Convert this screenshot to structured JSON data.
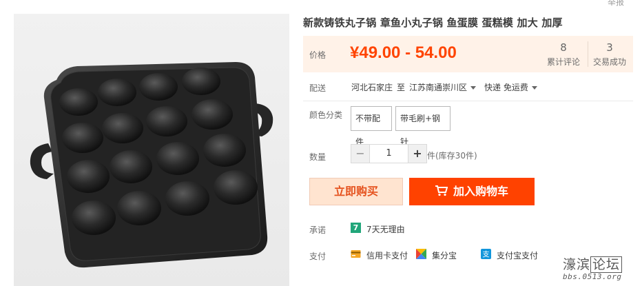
{
  "report_link": "举报",
  "product": {
    "title": "新款铸铁丸子锅 章鱼小丸子锅 鱼蛋膜 蛋糕模 加大 加厚"
  },
  "price": {
    "label": "价格",
    "value": "¥49.00 - 54.00",
    "reviews_count": "8",
    "reviews_label": "累计评论",
    "sales_count": "3",
    "sales_label": "交易成功"
  },
  "delivery": {
    "label": "配送",
    "from": "河北石家庄",
    "to_word": "至",
    "to": "江苏南通崇川区",
    "method": "快递 免运费"
  },
  "sku": {
    "label": "颜色分类",
    "options": [
      "不带配件",
      "带毛刷+钢针"
    ]
  },
  "quantity": {
    "label": "数量",
    "minus": "−",
    "value": "1",
    "plus": "+",
    "stock": "件(库存30件)"
  },
  "actions": {
    "buy_now": "立即购买",
    "add_to_cart": "加入购物车"
  },
  "promise": {
    "label": "承诺",
    "badge": "7",
    "text": "7天无理由"
  },
  "payment": {
    "label": "支付",
    "methods": [
      {
        "name": "信用卡支付",
        "icon": "credit-card-icon"
      },
      {
        "name": "集分宝",
        "icon": "jifenbao-icon"
      },
      {
        "name": "支付宝支付",
        "icon": "alipay-icon"
      }
    ]
  },
  "watermark": {
    "main_left": "濠滨",
    "main_box": "论坛",
    "sub": "bbs.0513.org"
  },
  "colors": {
    "accent": "#ff4400",
    "price_bg": "#fff2e8",
    "cart_button": "#ff4200",
    "buy_button_bg": "#ffe4d0",
    "promise_badge": "#21a67a"
  }
}
